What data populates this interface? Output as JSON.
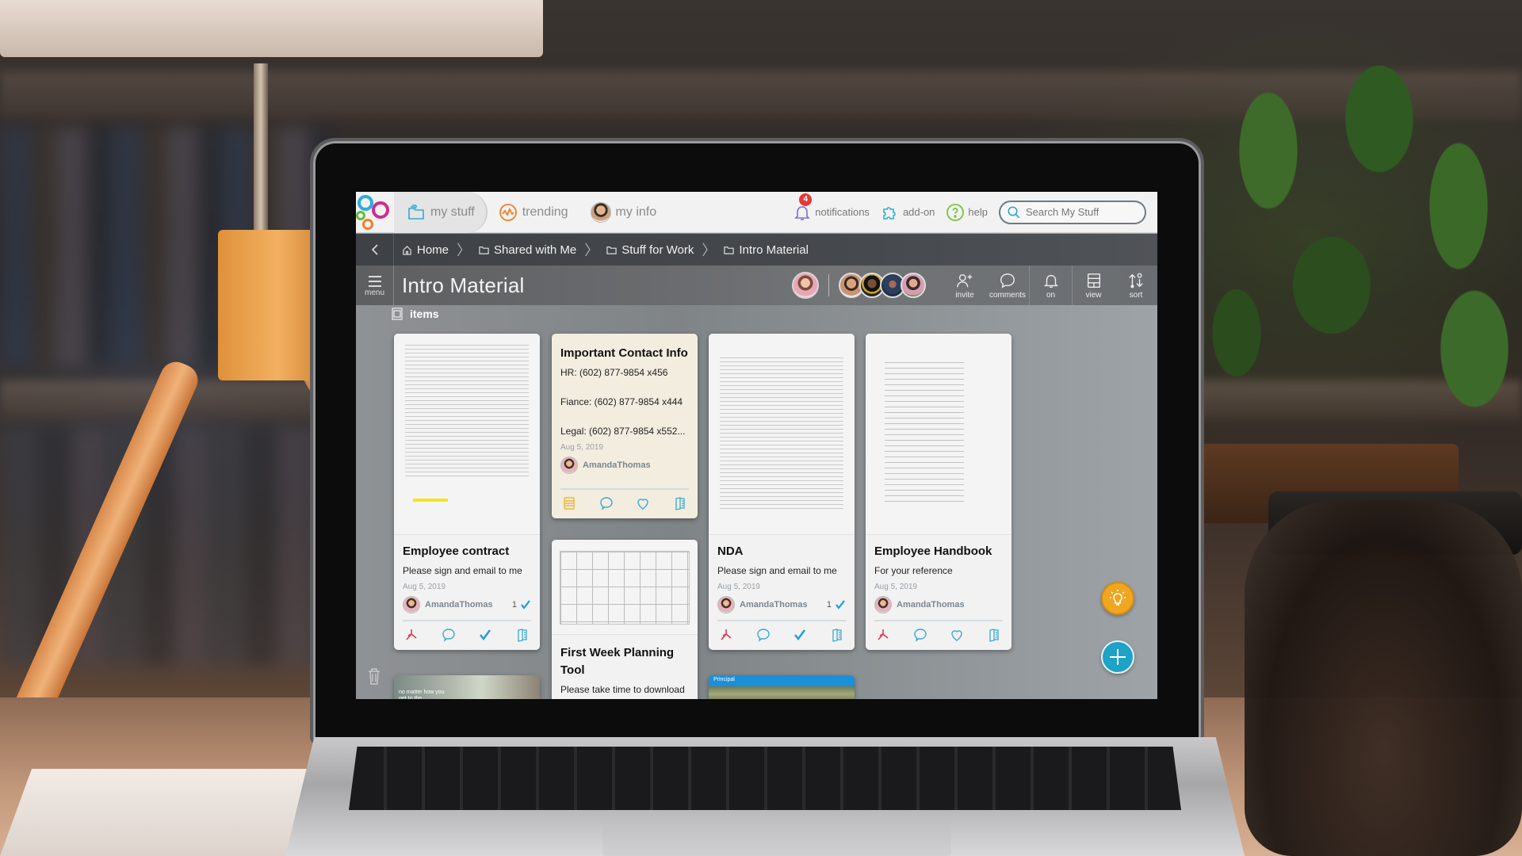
{
  "topnav": {
    "tabs": [
      {
        "label": "my stuff",
        "icon": "folders-icon",
        "active": true
      },
      {
        "label": "trending",
        "icon": "trending-icon",
        "active": false
      },
      {
        "label": "my info",
        "icon": "avatar",
        "active": false
      }
    ],
    "notifications": {
      "label": "notifications",
      "count": "4"
    },
    "addon": {
      "label": "add-on"
    },
    "help": {
      "label": "help"
    },
    "search": {
      "placeholder": "Search My Stuff",
      "value": ""
    }
  },
  "breadcrumb": [
    {
      "label": "Home",
      "icon": "home-icon"
    },
    {
      "label": "Shared with Me",
      "icon": "folder-icon"
    },
    {
      "label": "Stuff for Work",
      "icon": "folder-icon"
    },
    {
      "label": "Intro Material",
      "icon": "folder-icon"
    }
  ],
  "titlebar": {
    "menu_label": "menu",
    "title": "Intro Material",
    "tools": [
      {
        "label": "invite",
        "icon": "add-user-icon"
      },
      {
        "label": "comments",
        "icon": "comment-icon"
      },
      {
        "label": "on",
        "icon": "bell-icon"
      },
      {
        "label": "view",
        "icon": "view-layout-icon"
      },
      {
        "label": "sort",
        "icon": "sort-icon"
      }
    ]
  },
  "section": {
    "label": "items"
  },
  "cards": [
    {
      "type": "document",
      "title": "Employee contract",
      "subtitle": "Please sign and email to me",
      "date": "Aug 5, 2019",
      "owner": "AmandaThomas",
      "check_count": "1",
      "actions": [
        "pdf",
        "comment",
        "check",
        "details"
      ]
    },
    {
      "type": "note",
      "title": "Important Contact Info",
      "lines": [
        "HR: (602) 877-9854 x456",
        "Fiance: (602) 877-9854 x444",
        "Legal: (602) 877-9854 x552..."
      ],
      "date": "Aug 5, 2019",
      "owner": "AmandaThomas",
      "actions": [
        "note",
        "comment",
        "like",
        "details"
      ]
    },
    {
      "type": "document",
      "title": "First Week Planning Tool",
      "subtitle": "Please take time to download"
    },
    {
      "type": "document",
      "title": "NDA",
      "subtitle": "Please sign and email to me",
      "date": "Aug 5, 2019",
      "owner": "AmandaThomas",
      "check_count": "1",
      "actions": [
        "pdf",
        "comment",
        "check",
        "details"
      ]
    },
    {
      "type": "document",
      "title": "Employee Handbook",
      "subtitle": "For your reference",
      "date": "Aug 5, 2019",
      "owner": "AmandaThomas",
      "actions": [
        "pdf",
        "comment",
        "like",
        "details"
      ]
    },
    {
      "type": "video",
      "caption": "no matter how you get to the"
    },
    {
      "type": "web-link",
      "brand": "Principal"
    }
  ],
  "colors": {
    "accent_blue": "#1ea2c7",
    "tip_orange": "#f0a620",
    "badge_red": "#e53935",
    "pdf_red": "#e0394f",
    "note_card_bg": "#f3ede0"
  }
}
